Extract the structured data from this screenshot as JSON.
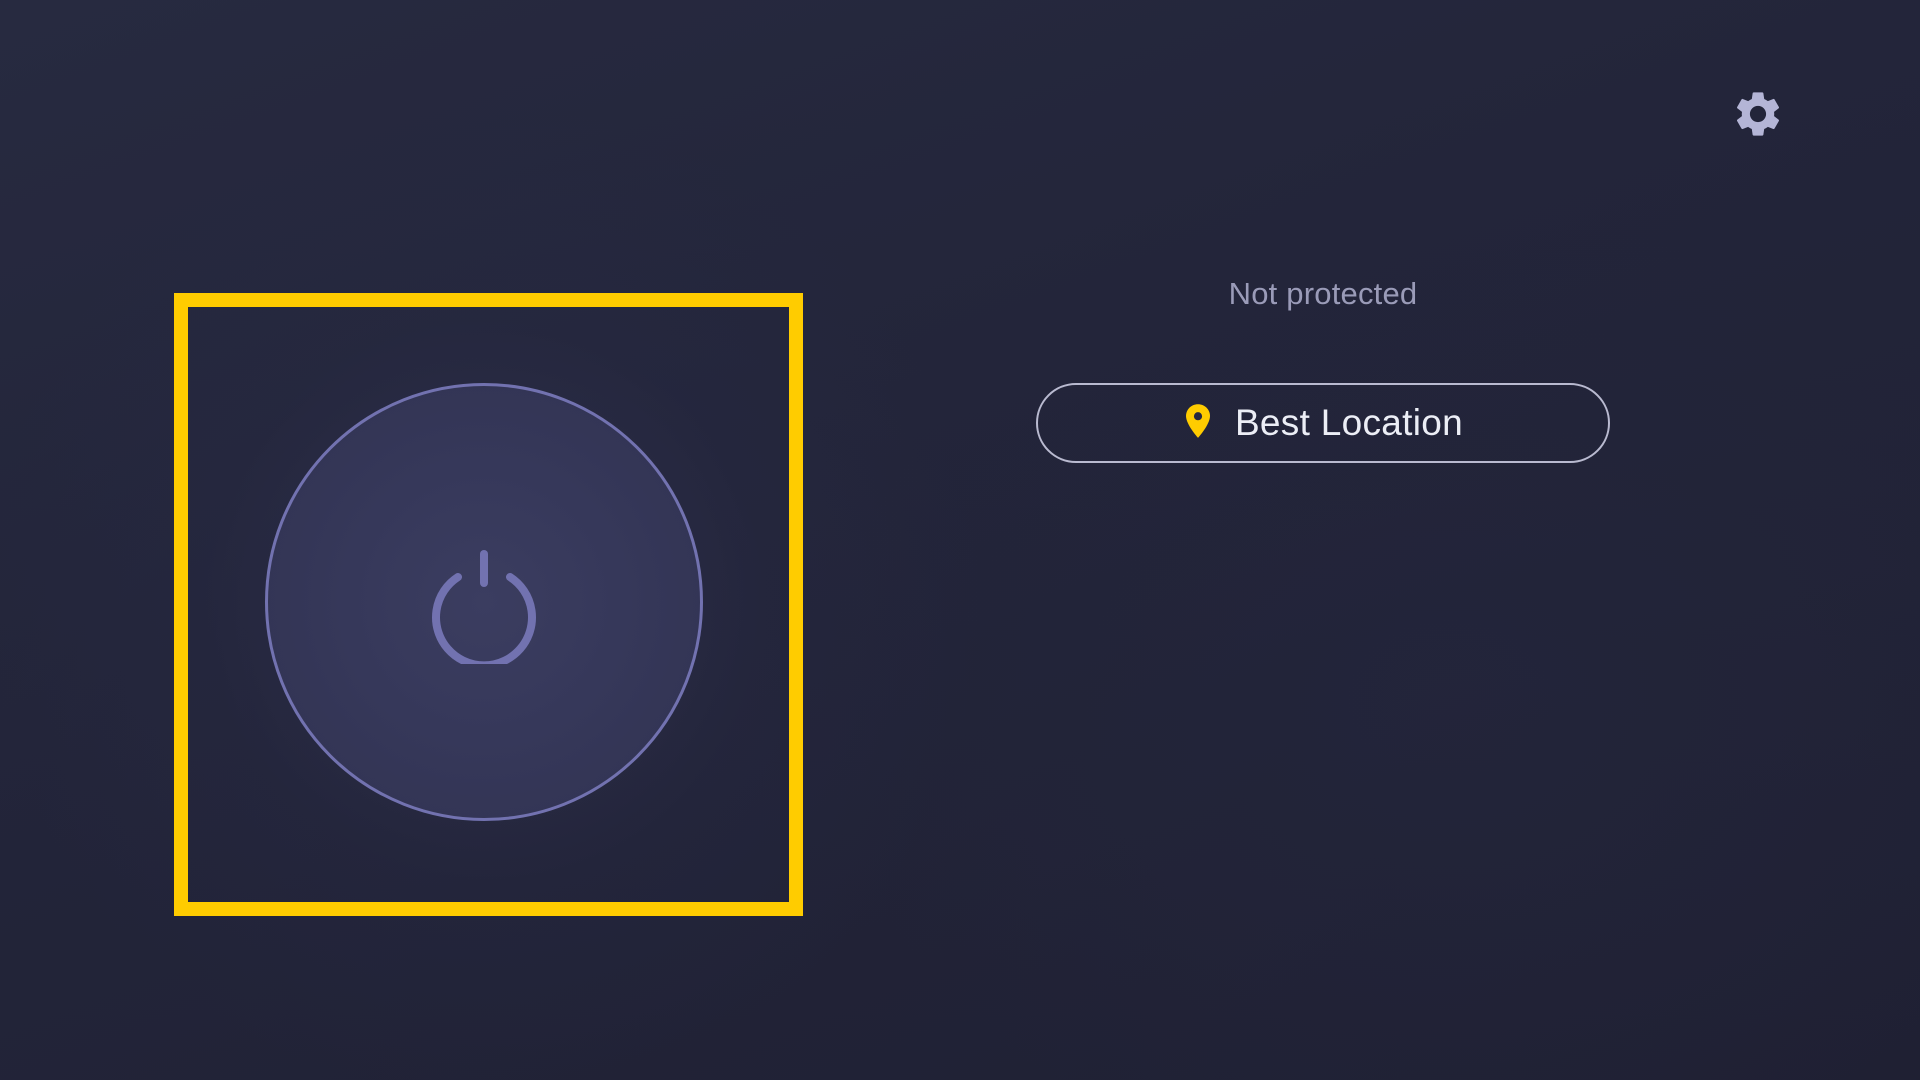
{
  "header": {
    "settings_icon": "gear-icon"
  },
  "connect": {
    "power_icon": "power-icon",
    "state": "disconnected"
  },
  "status": {
    "text": "Not protected"
  },
  "location": {
    "icon": "location-pin-icon",
    "label": "Best Location"
  },
  "colors": {
    "accent": "#ffcc00",
    "ring": "#7272b0",
    "status_text": "#9a9bb8",
    "gear": "#b4b5d6"
  }
}
